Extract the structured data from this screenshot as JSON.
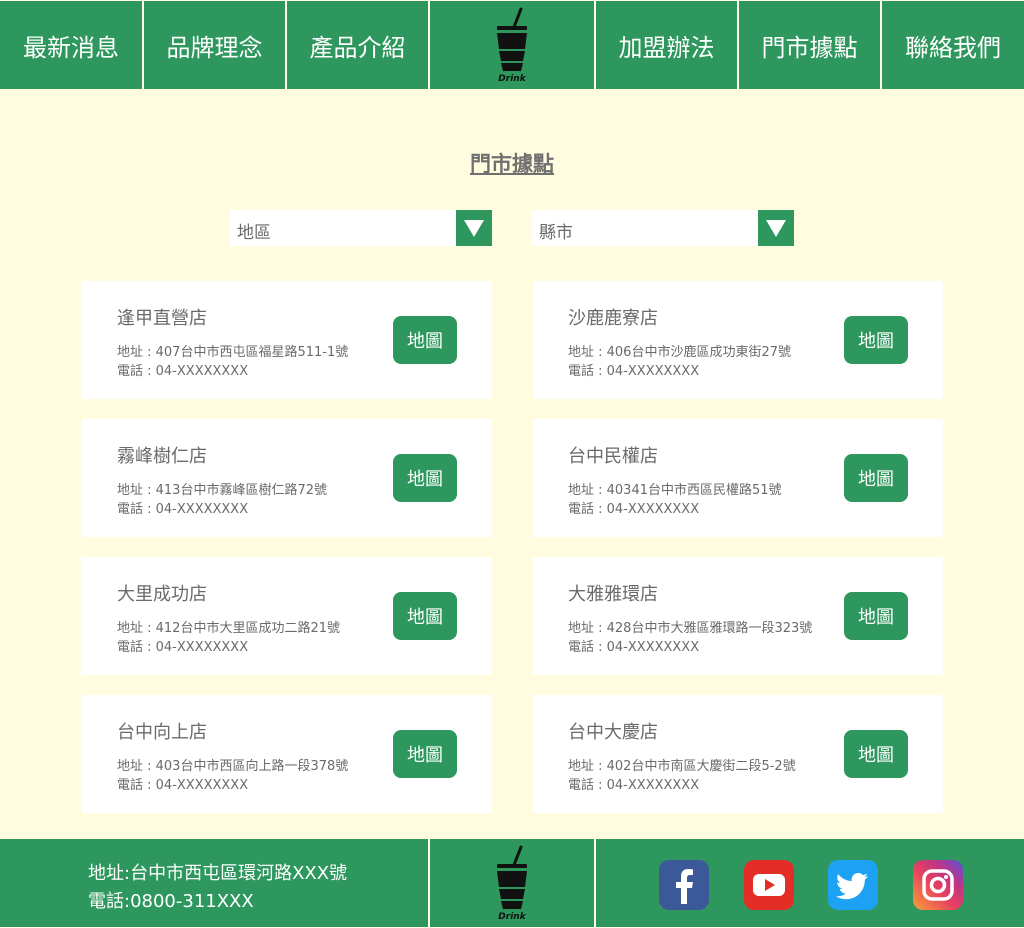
{
  "nav": {
    "items_left": [
      "最新消息",
      "品牌理念",
      "產品介紹"
    ],
    "items_right": [
      "加盟辦法",
      "門市據點",
      "聯絡我們"
    ],
    "logo_text": "Drink"
  },
  "section_title": "門市據點",
  "filters": {
    "region": "地區",
    "city": "縣市"
  },
  "stores": [
    {
      "name": "逢甲直營店",
      "address": "地址 : 407台中市西屯區福星路511-1號",
      "phone": "電話 : 04-XXXXXXXX",
      "button": "地圖"
    },
    {
      "name": "沙鹿鹿寮店",
      "address": "地址 : 406台中市沙鹿區成功東街27號",
      "phone": "電話 : 04-XXXXXXXX",
      "button": "地圖"
    },
    {
      "name": "霧峰樹仁店",
      "address": "地址 : 413台中市霧峰區樹仁路72號",
      "phone": "電話 : 04-XXXXXXXX",
      "button": "地圖"
    },
    {
      "name": "台中民權店",
      "address": "地址 : 40341台中市西區民權路51號",
      "phone": "電話 : 04-XXXXXXXX",
      "button": "地圖"
    },
    {
      "name": "大里成功店",
      "address": "地址 : 412台中市大里區成功二路21號",
      "phone": "電話 : 04-XXXXXXXX",
      "button": "地圖"
    },
    {
      "name": "大雅雅環店",
      "address": "地址 : 428台中市大雅區雅環路一段323號",
      "phone": "電話 : 04-XXXXXXXX",
      "button": "地圖"
    },
    {
      "name": "台中向上店",
      "address": "地址 : 403台中市西區向上路一段378號",
      "phone": "電話 : 04-XXXXXXXX",
      "button": "地圖"
    },
    {
      "name": "台中大慶店",
      "address": "地址 : 402台中市南區大慶街二段5-2號",
      "phone": "電話 : 04-XXXXXXXX",
      "button": "地圖"
    }
  ],
  "footer": {
    "address": "地址:台中市西屯區環河路XXX號",
    "phone": "電話:0800-311XXX",
    "logo_text": "Drink",
    "social": [
      "facebook-icon",
      "youtube-icon",
      "twitter-icon",
      "instagram-icon"
    ]
  },
  "colors": {
    "brand_green": "#2d975d",
    "background": "#fffcdf",
    "text_gray": "#6a6a6a"
  }
}
